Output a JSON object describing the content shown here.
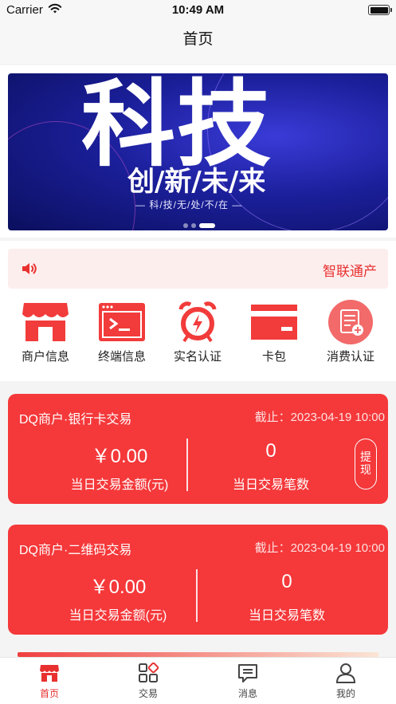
{
  "status_bar": {
    "carrier": "Carrier",
    "time": "10:49 AM"
  },
  "nav": {
    "title": "首页"
  },
  "banner": {
    "big_text": "科技",
    "slogan": "创/新/未/来",
    "sub": "— 科/技/无/处/不/在 —",
    "slides": 3,
    "active_slide": 3
  },
  "notice": {
    "text": "智联通产"
  },
  "menu": [
    {
      "label": "商户信息",
      "icon": "storefront-icon"
    },
    {
      "label": "终端信息",
      "icon": "terminal-icon"
    },
    {
      "label": "实名认证",
      "icon": "alarm-clock-icon"
    },
    {
      "label": "卡包",
      "icon": "card-icon"
    },
    {
      "label": "消费认证",
      "icon": "document-add-icon"
    }
  ],
  "cards": [
    {
      "title": "DQ商户·银行卡交易",
      "date": "截止：2023-04-19 10:00",
      "amount": "￥0.00",
      "amount_label": "当日交易金额(元)",
      "count": "0",
      "count_label": "当日交易笔数",
      "withdraw": "提现"
    },
    {
      "title": "DQ商户·二维码交易",
      "date": "截止：2023-04-19 10:00",
      "amount": "￥0.00",
      "amount_label": "当日交易金额(元)",
      "count": "0",
      "count_label": "当日交易笔数"
    }
  ],
  "tabs": [
    {
      "label": "首页",
      "icon": "home-store-icon",
      "active": true
    },
    {
      "label": "交易",
      "icon": "grid-icon",
      "active": false
    },
    {
      "label": "消息",
      "icon": "message-icon",
      "active": false
    },
    {
      "label": "我的",
      "icon": "user-icon",
      "active": false
    }
  ],
  "colors": {
    "accent": "#f5383a",
    "accent_text": "#e8312f",
    "notice_bg": "#fdeeee",
    "banner_bg": "#1b1f9a"
  }
}
